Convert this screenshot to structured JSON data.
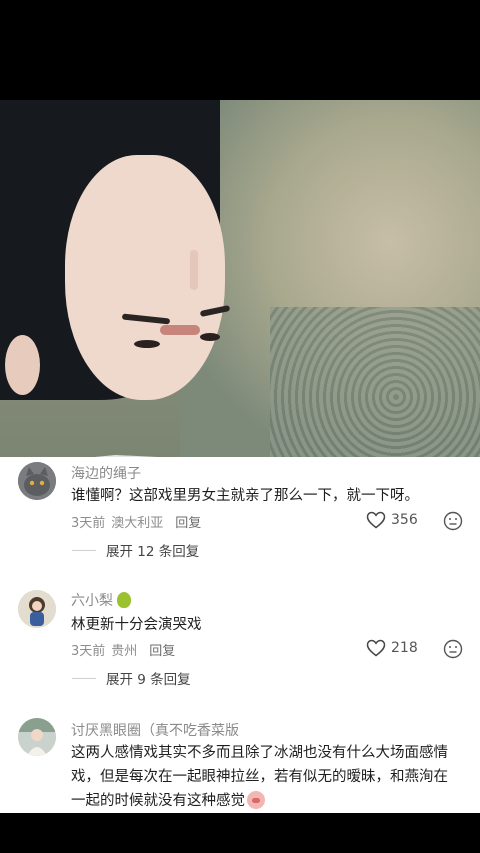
{
  "comments": [
    {
      "username": "海边的绳子",
      "text": "谁懂啊？这部戏里男女主就亲了那么一下，就一下呀。",
      "time": "3天前",
      "location": "澳大利亚",
      "reply_label": "回复",
      "likes": "356",
      "expand_label": "展开 12 条回复"
    },
    {
      "username": "六小梨",
      "text": "林更新十分会演哭戏",
      "time": "3天前",
      "location": "贵州",
      "reply_label": "回复",
      "likes": "218",
      "expand_label": "展开 9 条回复"
    },
    {
      "username": "讨厌黑眼圈（真不吃香菜版",
      "text": "这两人感情戏其实不多而且除了冰湖也没有什么大场面感情戏，但是每次在一起眼神拉丝，若有似无的暧昧，和燕洵在一起的时候就没有这种感觉"
    }
  ]
}
